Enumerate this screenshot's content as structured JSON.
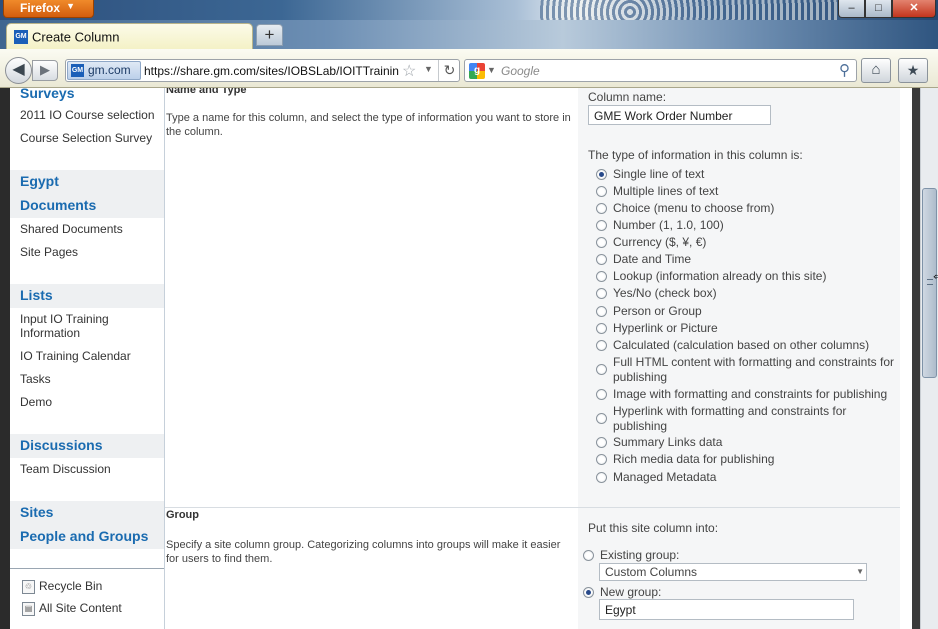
{
  "browser": {
    "menu_label": "Firefox",
    "tab": {
      "title": "Create Column",
      "favicon": "gm-icon"
    },
    "new_tab_label": "+",
    "identity_domain": "gm.com",
    "url": "https://share.gm.com/sites/IOBSLab/IOITTraining",
    "search_placeholder": "Google",
    "window_controls": {
      "minimize": "‒",
      "maximize": "□",
      "close": "✕"
    }
  },
  "quick_launch": {
    "sections": [
      {
        "header": "Surveys",
        "items": [
          "2011 IO Course selection",
          "Course Selection Survey"
        ]
      },
      {
        "header": "Egypt",
        "items": []
      },
      {
        "header": "Documents",
        "items": [
          "Shared Documents",
          "Site Pages"
        ]
      },
      {
        "header": "Lists",
        "items": [
          "Input IO Training Information",
          "IO Training Calendar",
          "Tasks",
          "Demo"
        ]
      },
      {
        "header": "Discussions",
        "items": [
          "Team Discussion"
        ]
      },
      {
        "header": "Sites",
        "items": []
      },
      {
        "header": "People and Groups",
        "items": []
      }
    ],
    "tools": [
      "Recycle Bin",
      "All Site Content"
    ]
  },
  "name_and_type": {
    "title": "Name and Type",
    "description": "Type a name for this column, and select the type of information you want to store in the column.",
    "column_name_label": "Column name:",
    "column_name_value": "GME Work Order Number",
    "type_prompt": "The type of information in this column is:",
    "selected_type": "Single line of text",
    "types": [
      "Single line of text",
      "Multiple lines of text",
      "Choice (menu to choose from)",
      "Number (1, 1.0, 100)",
      "Currency ($, ¥, €)",
      "Date and Time",
      "Lookup (information already on this site)",
      "Yes/No (check box)",
      "Person or Group",
      "Hyperlink or Picture",
      "Calculated (calculation based on other columns)",
      "Full HTML content with formatting and constraints for publishing",
      "Image with formatting and constraints for publishing",
      "Hyperlink with formatting and constraints for publishing",
      "Summary Links data",
      "Rich media data for publishing",
      "Managed Metadata"
    ]
  },
  "group": {
    "title": "Group",
    "description": "Specify a site column group. Categorizing columns into groups will make it easier for users to find them.",
    "put_into_label": "Put this site column into:",
    "existing_label": "Existing group:",
    "existing_value": "Custom Columns",
    "new_label": "New group:",
    "new_value": "Egypt",
    "selected": "new"
  }
}
